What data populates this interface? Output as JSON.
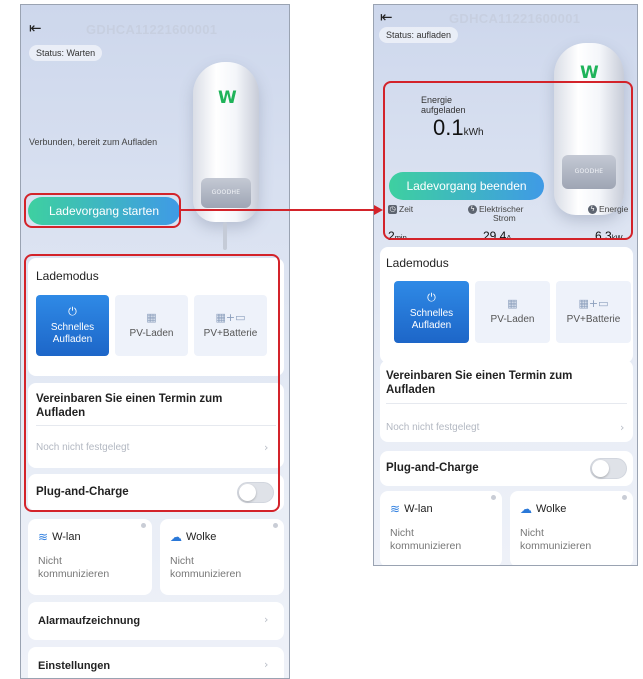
{
  "left_screen": {
    "back_icon": "exit-icon",
    "device_id": "GDHCA11221600001",
    "status": "Status: Warten",
    "connected_text": "Verbunden, bereit zum Aufladen",
    "start_button": "Ladevorgang starten",
    "charger_logo": "W",
    "charger_plate": "GOODHE",
    "lademodus": {
      "title": "Lademodus",
      "modes": [
        {
          "line1": "Schnelles",
          "line2": "Aufladen",
          "icon": "bolt-icon",
          "active": true
        },
        {
          "line1": "PV-Laden",
          "line2": "",
          "icon": "solar-panel-icon",
          "active": false
        },
        {
          "line1": "PV+Batterie",
          "line2": "",
          "icon": "solar-battery-icon",
          "active": false
        }
      ]
    },
    "termin": {
      "title_line1": "Vereinbaren Sie einen Termin zum",
      "title_line2": "Aufladen",
      "value": "Noch nicht festgelegt"
    },
    "plug_and_charge": "Plug-and-Charge",
    "wlan": {
      "title": "W-lan",
      "status_line1": "Nicht",
      "status_line2": "kommunizieren"
    },
    "wolke": {
      "title": "Wolke",
      "status_line1": "Nicht",
      "status_line2": "kommunizieren"
    },
    "alarm": "Alarmaufzeichnung",
    "settings": "Einstellungen"
  },
  "right_screen": {
    "back_icon": "exit-icon",
    "device_id": "GDHCA11221600001",
    "status": "Status: aufladen",
    "energy_label": "Energie aufgeladen",
    "energy_value": "0.1",
    "energy_unit": "kWh",
    "stop_button": "Ladevorgang beenden",
    "charger_logo": "W",
    "charger_plate": "GOODHE",
    "stats": {
      "zeit_label": "Zeit",
      "zeit_value": "2",
      "zeit_unit": "min",
      "strom_label_line1": "Elektrischer",
      "strom_label_line2": "Strom",
      "strom_value": "29.4",
      "strom_unit": "A",
      "energie_label": "Energie",
      "energie_value": "6.3",
      "energie_unit": "kW"
    },
    "lademodus": {
      "title": "Lademodus",
      "modes": [
        {
          "line1": "Schnelles",
          "line2": "Aufladen",
          "icon": "bolt-icon",
          "active": true
        },
        {
          "line1": "PV-Laden",
          "line2": "",
          "icon": "solar-panel-icon",
          "active": false
        },
        {
          "line1": "PV+Batterie",
          "line2": "",
          "icon": "solar-battery-icon",
          "active": false
        }
      ]
    },
    "termin": {
      "title_line1": "Vereinbaren Sie einen Termin zum",
      "title_line2": "Aufladen",
      "value": "Noch nicht festgelegt"
    },
    "plug_and_charge": "Plug-and-Charge",
    "wlan": {
      "title": "W-lan",
      "status_line1": "Nicht",
      "status_line2": "kommunizieren"
    },
    "wolke": {
      "title": "Wolke",
      "status_line1": "Nicht",
      "status_line2": "kommunizieren"
    }
  },
  "colors": {
    "highlight": "#d3232a",
    "accent_blue": "#1d66c8",
    "button_gradient_start": "#3ed0a0",
    "button_gradient_end": "#3f9ae6",
    "logo_green": "#1fb35a"
  }
}
